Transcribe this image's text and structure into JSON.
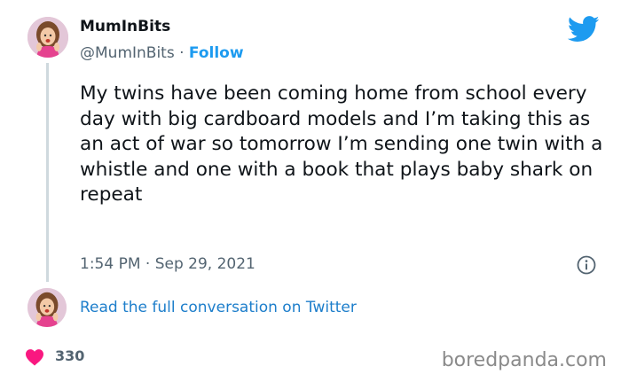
{
  "tweet": {
    "display_name": "MumInBits",
    "handle": "@MumInBits",
    "separator": "·",
    "follow_label": "Follow",
    "text": "My twins have been coming home from school every day with big cardboard models and I’m taking this as an act of war so tomorrow I’m sending one twin with a whistle and one with a book that plays baby shark on repeat",
    "time": "1:54 PM",
    "date": "Sep 29, 2021",
    "read_more": "Read the full conversation on Twitter",
    "likes": "330"
  },
  "watermark": "boredpanda.com",
  "icons": {
    "brand": "twitter-bird-icon",
    "info": "info-icon",
    "like": "heart-icon"
  },
  "colors": {
    "twitter_blue": "#1d9bf0",
    "link_blue": "#1d7ecb",
    "heart": "#f91880",
    "muted": "#536471",
    "avatar_bg": "#e3c7d8",
    "thread_line": "#cfd9de"
  }
}
